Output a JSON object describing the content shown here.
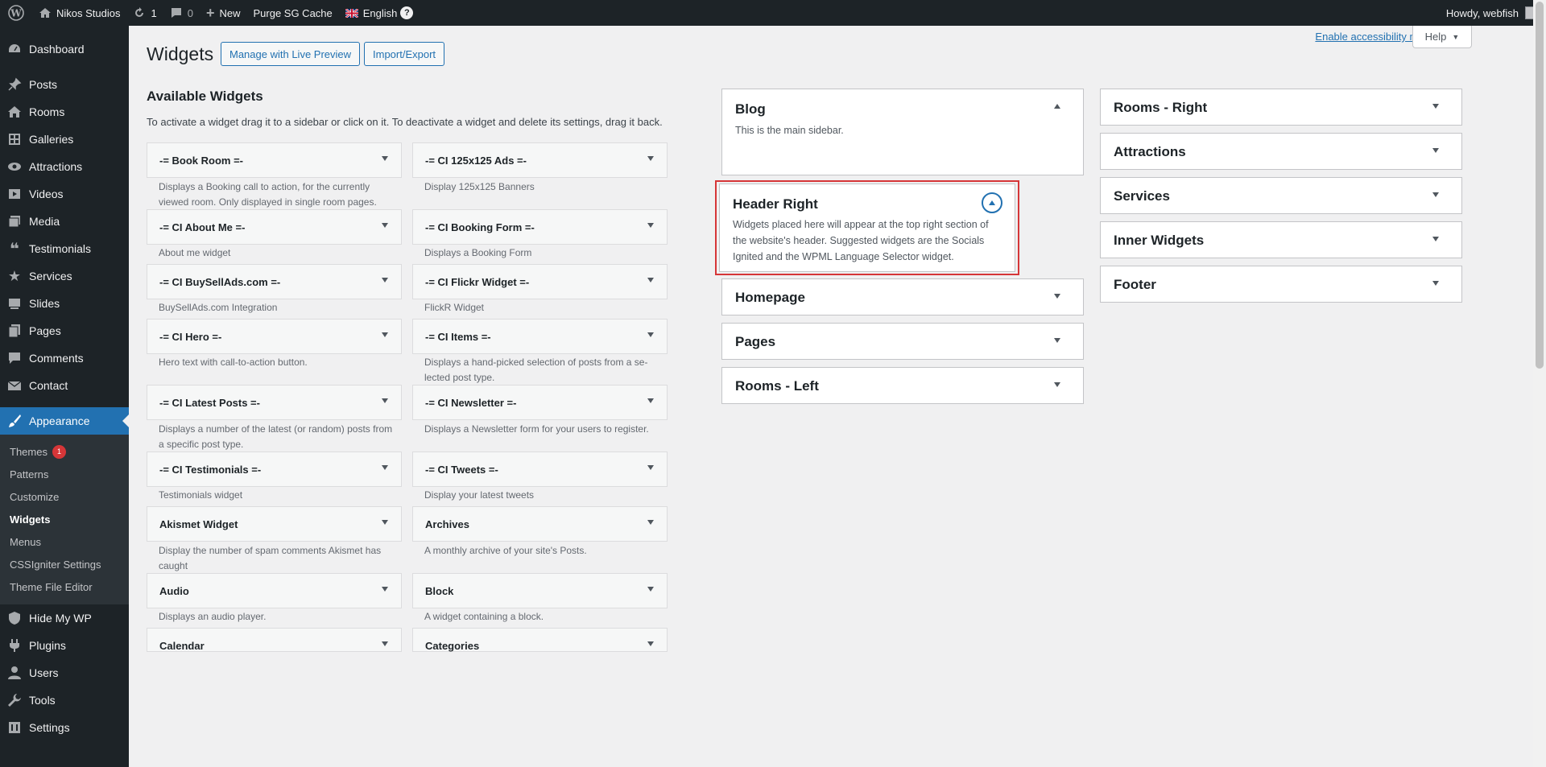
{
  "adminbar": {
    "site_name": "Nikos Studios",
    "updates_count": "1",
    "comments_count": "0",
    "new_label": "New",
    "purge_label": "Purge SG Cache",
    "language_label": "English",
    "howdy": "Howdy, webfish"
  },
  "menu": {
    "items_top": [
      {
        "label": "Dashboard",
        "icon": "dashboard-icon"
      }
    ],
    "items_main": [
      {
        "label": "Posts",
        "icon": "pin-icon"
      },
      {
        "label": "Rooms",
        "icon": "home-icon"
      },
      {
        "label": "Galleries",
        "icon": "gallery-icon"
      },
      {
        "label": "Attractions",
        "icon": "eye-icon"
      },
      {
        "label": "Videos",
        "icon": "video-icon"
      },
      {
        "label": "Media",
        "icon": "media-icon"
      },
      {
        "label": "Testimonials",
        "icon": "quote-icon"
      },
      {
        "label": "Services",
        "icon": "star-icon"
      },
      {
        "label": "Slides",
        "icon": "slides-icon"
      },
      {
        "label": "Pages",
        "icon": "pages-icon"
      },
      {
        "label": "Comments",
        "icon": "comment-icon"
      },
      {
        "label": "Contact",
        "icon": "mail-icon"
      }
    ],
    "appearance": {
      "label": "Appearance",
      "icon": "brush-icon"
    },
    "sub_items": [
      {
        "label": "Themes",
        "badge": "1"
      },
      {
        "label": "Patterns"
      },
      {
        "label": "Customize"
      },
      {
        "label": "Widgets"
      },
      {
        "label": "Menus"
      },
      {
        "label": "CSSIgniter Settings"
      },
      {
        "label": "Theme File Editor"
      }
    ],
    "items_bottom": [
      {
        "label": "Hide My WP",
        "icon": "shield-icon"
      },
      {
        "label": "Plugins",
        "icon": "plugin-icon"
      },
      {
        "label": "Users",
        "icon": "user-icon"
      },
      {
        "label": "Tools",
        "icon": "wrench-icon"
      },
      {
        "label": "Settings",
        "icon": "settings-icon"
      }
    ]
  },
  "header": {
    "title": "Widgets",
    "live_preview_btn": "Manage with Live Preview",
    "import_export_btn": "Import/Export",
    "accessibility_link": "Enable accessibility mode",
    "help_label": "Help"
  },
  "available": {
    "title": "Available Widgets",
    "description": "To activate a widget drag it to a sidebar or click on it. To deactivate a widget and delete its settings, drag it back.",
    "widgets": [
      {
        "name": "-= Book Room =-",
        "desc": "Displays a Booking call to action, for the currently viewed room. Only displayed in single room pages."
      },
      {
        "name": "-= CI 125x125 Ads =-",
        "desc": "Display 125x125 Banners"
      },
      {
        "name": "-= CI About Me =-",
        "desc": "About me widget"
      },
      {
        "name": "-= CI Booking Form =-",
        "desc": "Displays a Booking Form"
      },
      {
        "name": "-= CI BuySellAds.com =-",
        "desc": "BuySellAds.com Integration"
      },
      {
        "name": "-= CI Flickr Widget =-",
        "desc": "FlickR Widget"
      },
      {
        "name": "-= CI Hero =-",
        "desc": "Hero text with call-to-action button."
      },
      {
        "name": "-= CI Items =-",
        "desc": "Displays a hand-picked selection of posts from a se- lected post type."
      },
      {
        "name": "-= CI Latest Posts =-",
        "desc": "Displays a number of the latest (or random) posts from a specific post type."
      },
      {
        "name": "-= CI Newsletter =-",
        "desc": "Displays a Newsletter form for your users to register."
      },
      {
        "name": "-= CI Testimonials =-",
        "desc": "Testimonials widget"
      },
      {
        "name": "-= CI Tweets =-",
        "desc": "Display your latest tweets"
      },
      {
        "name": "Akismet Widget",
        "desc": "Display the number of spam comments Akismet has caught"
      },
      {
        "name": "Archives",
        "desc": "A monthly archive of your site's Posts."
      },
      {
        "name": "Audio",
        "desc": "Displays an audio player."
      },
      {
        "name": "Block",
        "desc": "A widget containing a block."
      },
      {
        "name": "Calendar",
        "desc": ""
      },
      {
        "name": "Categories",
        "desc": ""
      }
    ]
  },
  "sidebars_left": [
    {
      "title": "Blog",
      "desc": "This is the main sidebar.",
      "expanded": true
    },
    {
      "title": "Header Right",
      "desc": "Widgets placed here will appear at the top right section of the website's header. Suggested widgets are the Socials Ignited and the WPML Language Selector widget.",
      "expanded": true,
      "highlighted": true
    },
    {
      "title": "Homepage"
    },
    {
      "title": "Pages"
    },
    {
      "title": "Rooms - Left"
    }
  ],
  "sidebars_right": [
    {
      "title": "Rooms - Right"
    },
    {
      "title": "Attractions"
    },
    {
      "title": "Services"
    },
    {
      "title": "Inner Widgets"
    },
    {
      "title": "Footer"
    }
  ],
  "colors": {
    "admin_dark": "#1d2327",
    "accent_blue": "#2271b1",
    "highlight_red": "#d63638",
    "background": "#f0f0f1"
  }
}
